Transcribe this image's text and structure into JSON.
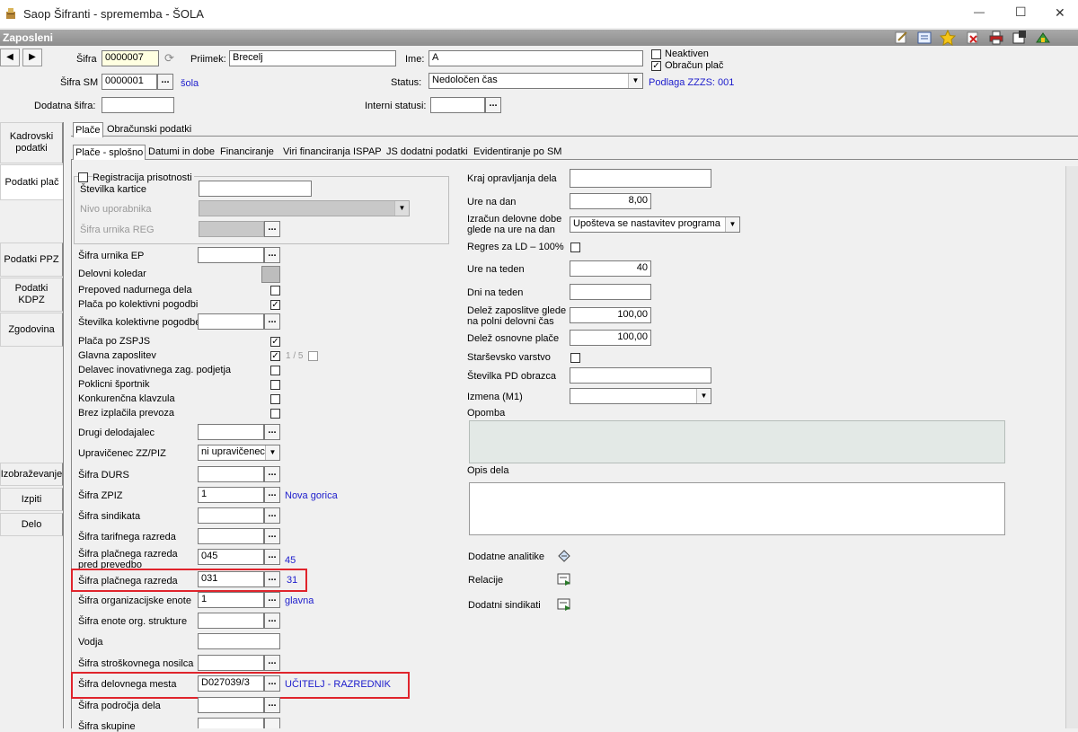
{
  "window": {
    "title": "Saop Šifranti - sprememba - ŠOLA",
    "min": "—",
    "max": "☐",
    "close": "✕"
  },
  "section": {
    "title": "Zaposleni"
  },
  "nav": {
    "prev": "◀",
    "next": "▶"
  },
  "header": {
    "sifra_label": "Šifra",
    "sifra_value": "0000007",
    "priimek_label": "Priimek:",
    "priimek_value": "Brecelj",
    "ime_label": "Ime:",
    "ime_value": "A",
    "neaktiven_label": "Neaktiven",
    "obracun_label": "Obračun plač",
    "sifra_sm_label": "Šifra SM",
    "sifra_sm_value": "0000001",
    "sifra_sm_link": "šola",
    "status_label": "Status:",
    "status_value": "Nedoločen čas",
    "podlaga_link": "Podlaga ZZZS: 001",
    "dodatna_label": "Dodatna šifra:",
    "dodatna_value": "",
    "interni_label": "Interni statusi:",
    "interni_value": "",
    "ellipsis": "..."
  },
  "sidebar": {
    "kadrovski": "Kadrovski podatki",
    "podatki_plac": "Podatki plač",
    "ppz": "Podatki PPZ",
    "kdpz": "Podatki KDPZ",
    "zgodovina": "Zgodovina",
    "izobrazevanje": "Izobraževanje",
    "izpiti": "Izpiti",
    "delo": "Delo"
  },
  "tabs_top": {
    "place": "Plače",
    "obracunski": "Obračunski podatki"
  },
  "tabs_sub": {
    "splosno": "Plače - splošno",
    "datumi": "Datumi in dobe",
    "financiranje": "Financiranje",
    "viri": "Viri financiranja ISPAP",
    "js": "JS dodatni podatki",
    "evid": "Evidentiranje po SM"
  },
  "left": {
    "registracija": "Registracija prisotnosti",
    "stevilka_kartice": "Številka kartice",
    "nivo": "Nivo uporabnika",
    "sifra_urnika_reg": "Šifra urnika REG",
    "sifra_urnika_ep": "Šifra urnika EP",
    "delovni_koledar": "Delovni koledar",
    "prepoved": "Prepoved nadurnega dela",
    "placa_kolektivni": "Plača po kolektivni pogodbi",
    "stevilka_kolektivne": "Številka kolektivne pogodbe",
    "placa_zspjs": "Plača po ZSPJS",
    "glavna": "Glavna zaposlitev",
    "glavna_count": "1 / 5",
    "inovativnega": "Delavec inovativnega zag. podjetja",
    "poklicni": "Poklicni športnik",
    "konkurencna": "Konkurenčna klavzula",
    "brez_prevoza": "Brez izplačila prevoza",
    "drugi_delodajalec": "Drugi delodajalec",
    "upravicenec": "Upravičenec ZZ/PIZ",
    "upravicenec_value": "ni upravičenec",
    "sifra_durs": "Šifra DURS",
    "sifra_zpiz": "Šifra ZPIZ",
    "sifra_zpiz_value": "1",
    "sifra_zpiz_link": "Nova gorica",
    "sifra_sindikata": "Šifra sindikata",
    "sifra_tarifnega": "Šifra tarifnega razreda",
    "sifra_placnega_pred": "Šifra plačnega razreda pred prevedbo",
    "sifra_placnega_pred_value": "045",
    "sifra_placnega_pred_link": "45",
    "sifra_placnega": "Šifra plačnega razreda",
    "sifra_placnega_value": "031",
    "sifra_placnega_link": "31",
    "sifra_org": "Šifra organizacijske enote",
    "sifra_org_value": "1",
    "sifra_org_link": "glavna",
    "sifra_enote_org": "Šifra enote org. strukture",
    "vodja": "Vodja",
    "sifra_stroskovnega": "Šifra stroškovnega nosilca",
    "sifra_delovnega": "Šifra delovnega mesta",
    "sifra_delovnega_value": "D027039/3",
    "sifra_delovnega_link": "UČITELJ - RAZREDNIK",
    "sifra_podrocja": "Šifra področja dela",
    "sifra_skupine": "Šifra skupine"
  },
  "right": {
    "kraj": "Kraj opravljanja dela",
    "ure_na_dan": "Ure na dan",
    "ure_na_dan_value": "8,00",
    "izracun": "Izračun delovne dobe glede na ure na dan",
    "izracun_value": "Upošteva se nastavitev programa",
    "regres": "Regres za LD – 100%",
    "ure_na_teden": "Ure na teden",
    "ure_na_teden_value": "40",
    "dni_na_teden": "Dni na teden",
    "delez_zaposlitve": "Delež zaposlitve glede na polni delovni čas",
    "delez_zaposlitve_value": "100,00",
    "delez_osnovne": "Delež osnovne plače",
    "delez_osnovne_value": "100,00",
    "starsevsko": "Starševsko varstvo",
    "stevilka_pd": "Številka PD obrazca",
    "izmena": "Izmena (M1)",
    "opomba": "Opomba",
    "opis_dela": "Opis dela",
    "dodatne_analitike": "Dodatne analitike",
    "relacije": "Relacije",
    "dodatni_sindikati": "Dodatni sindikati"
  },
  "colors": {
    "link": "#1c1ccc",
    "highlight": "#e0242c",
    "section_bar": "#9a9a9a"
  }
}
